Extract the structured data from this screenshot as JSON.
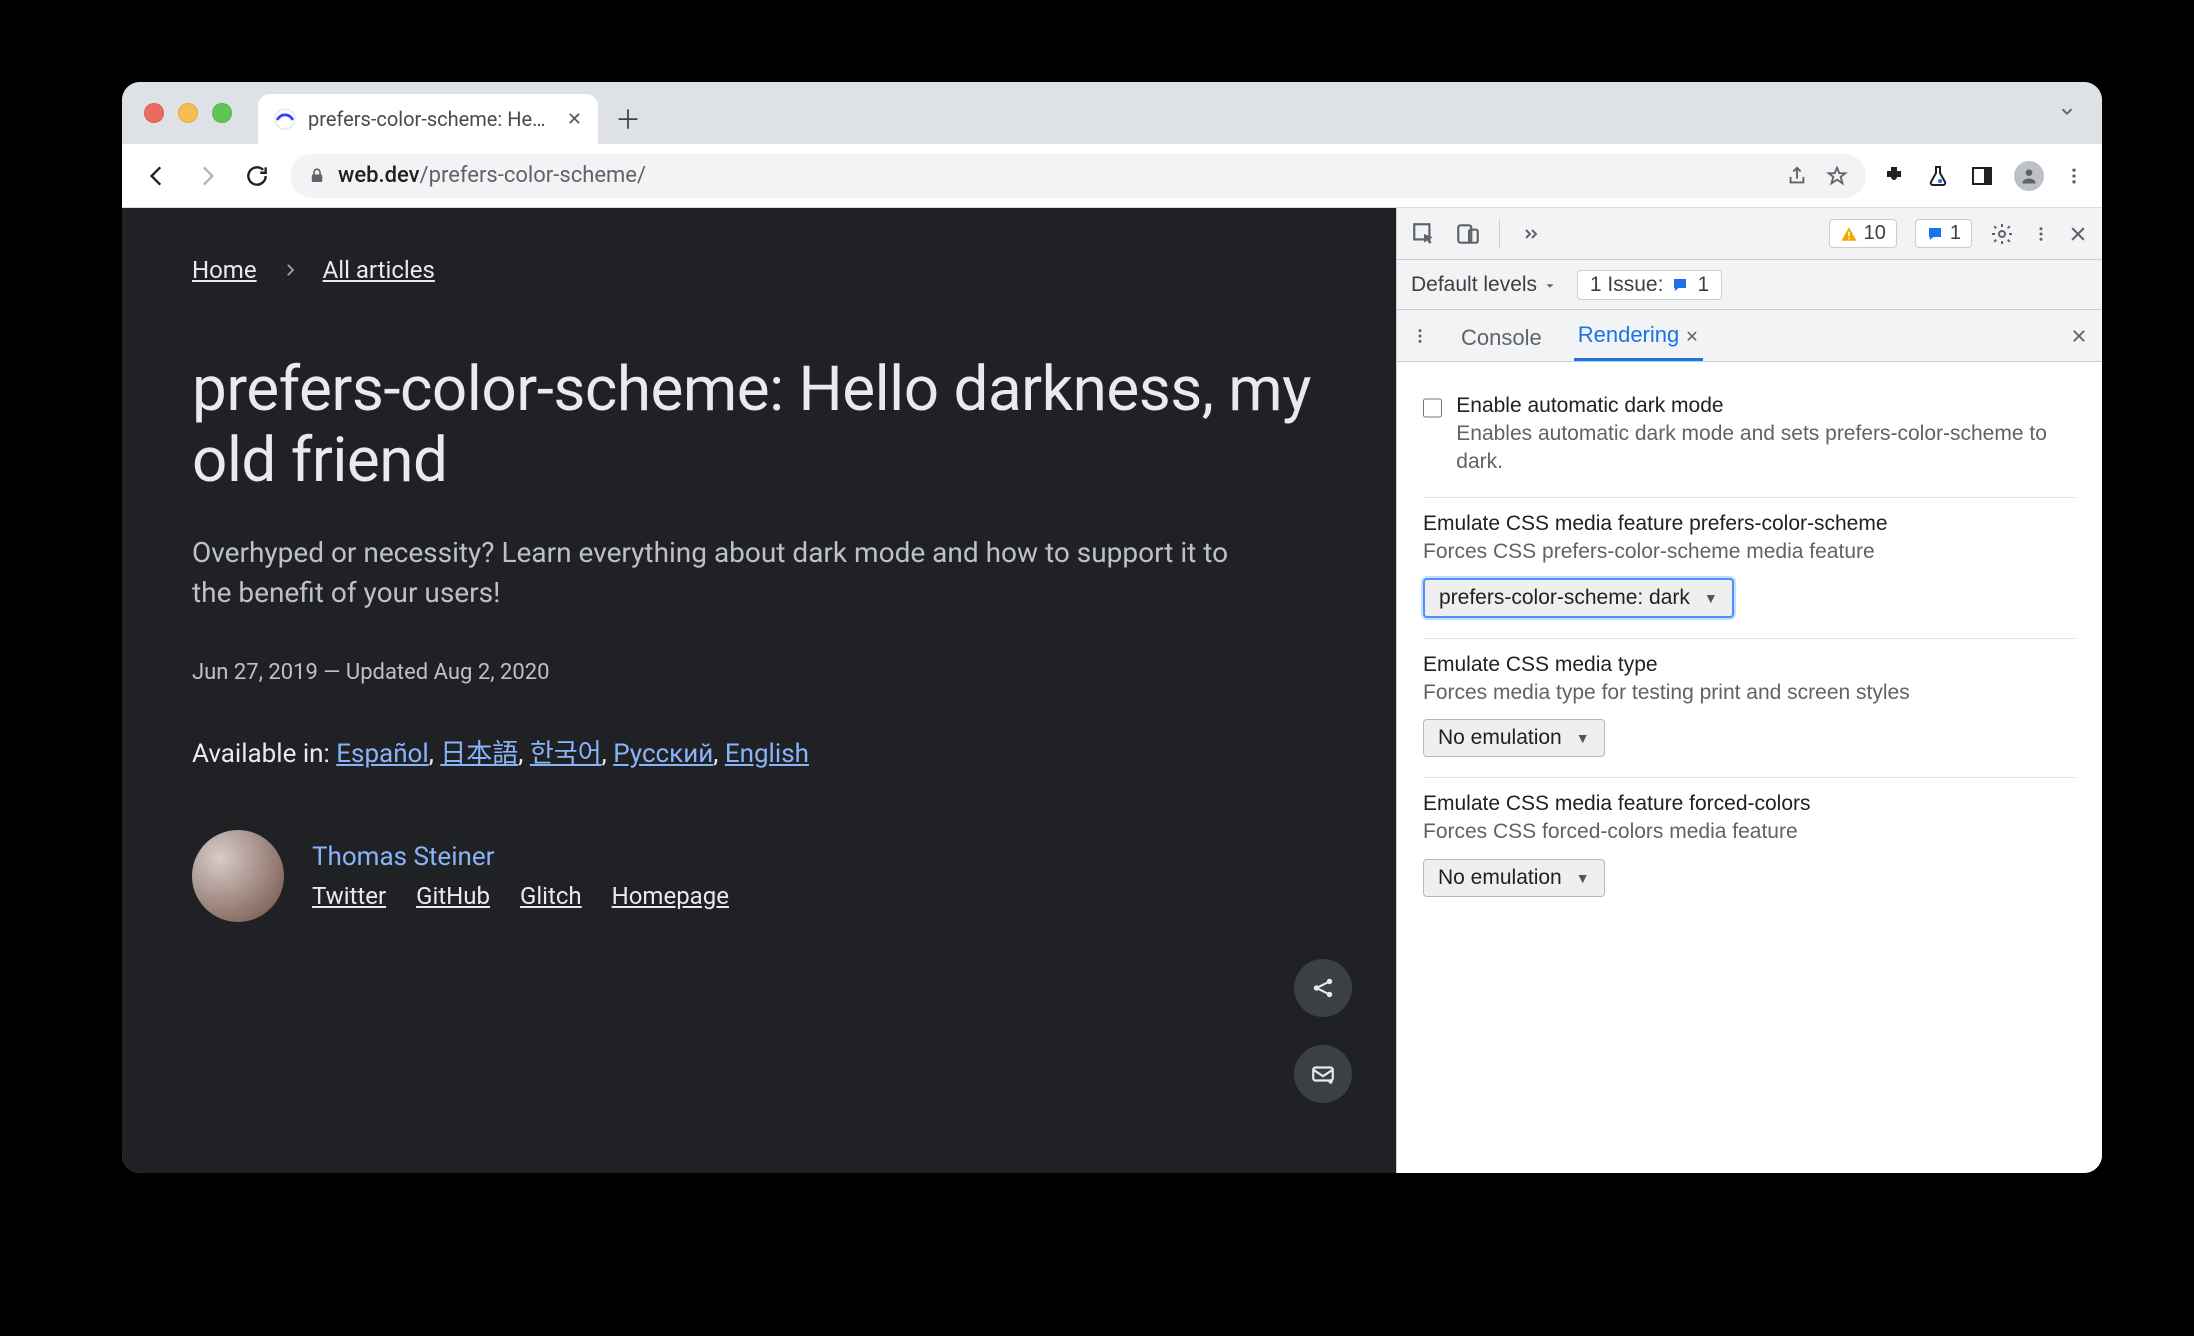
{
  "browser": {
    "tab_title": "prefers-color-scheme: Hello da",
    "url_host": "web.dev",
    "url_path": "/prefers-color-scheme/"
  },
  "page": {
    "breadcrumb": {
      "home": "Home",
      "all": "All articles"
    },
    "title": "prefers-color-scheme: Hello darkness, my old friend",
    "lede": "Overhyped or necessity? Learn everything about dark mode and how to support it to the benefit of your users!",
    "dateline": "Jun 27, 2019 — Updated Aug 2, 2020",
    "available_in_label": "Available in: ",
    "langs": [
      "Español",
      "日本語",
      "한국어",
      "Русский",
      "English"
    ],
    "author": {
      "name": "Thomas Steiner",
      "links": [
        "Twitter",
        "GitHub",
        "Glitch",
        "Homepage"
      ]
    }
  },
  "devtools": {
    "warn_count": "10",
    "msg_count": "1",
    "default_levels": "Default levels",
    "issue_label": "1 Issue:",
    "issue_count": "1",
    "tabs": {
      "console": "Console",
      "rendering": "Rendering"
    },
    "rendering": {
      "darkmode": {
        "title": "Enable automatic dark mode",
        "desc": "Enables automatic dark mode and sets prefers-color-scheme to dark."
      },
      "pcs": {
        "title": "Emulate CSS media feature prefers-color-scheme",
        "desc": "Forces CSS prefers-color-scheme media feature",
        "value": "prefers-color-scheme: dark"
      },
      "mediatype": {
        "title": "Emulate CSS media type",
        "desc": "Forces media type for testing print and screen styles",
        "value": "No emulation"
      },
      "forced": {
        "title": "Emulate CSS media feature forced-colors",
        "desc": "Forces CSS forced-colors media feature",
        "value": "No emulation"
      }
    }
  }
}
